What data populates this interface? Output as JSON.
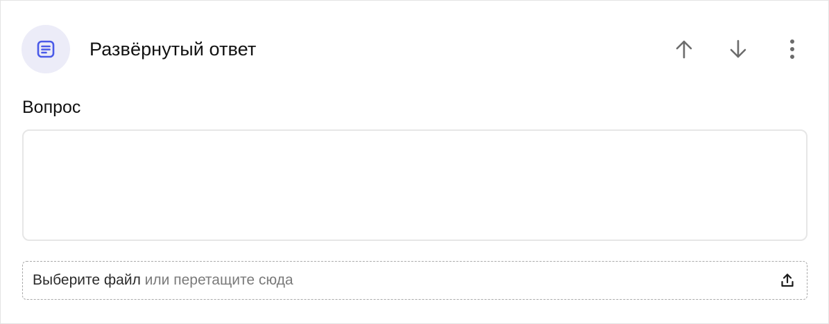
{
  "block": {
    "type_icon": "text-lines-icon",
    "type_title": "Развёрнутый ответ",
    "actions": {
      "move_up_icon": "arrow-up-icon",
      "move_down_icon": "arrow-down-icon",
      "more_icon": "more-vertical-icon"
    }
  },
  "question": {
    "label": "Вопрос",
    "value": ""
  },
  "upload": {
    "choose_text": "Выберите файл",
    "rest_text": " или перетащите сюда",
    "icon": "upload-icon"
  },
  "colors": {
    "accent": "#4a5ae8",
    "icon_bg": "#ececf8",
    "muted_icon": "#6b6b6b"
  }
}
